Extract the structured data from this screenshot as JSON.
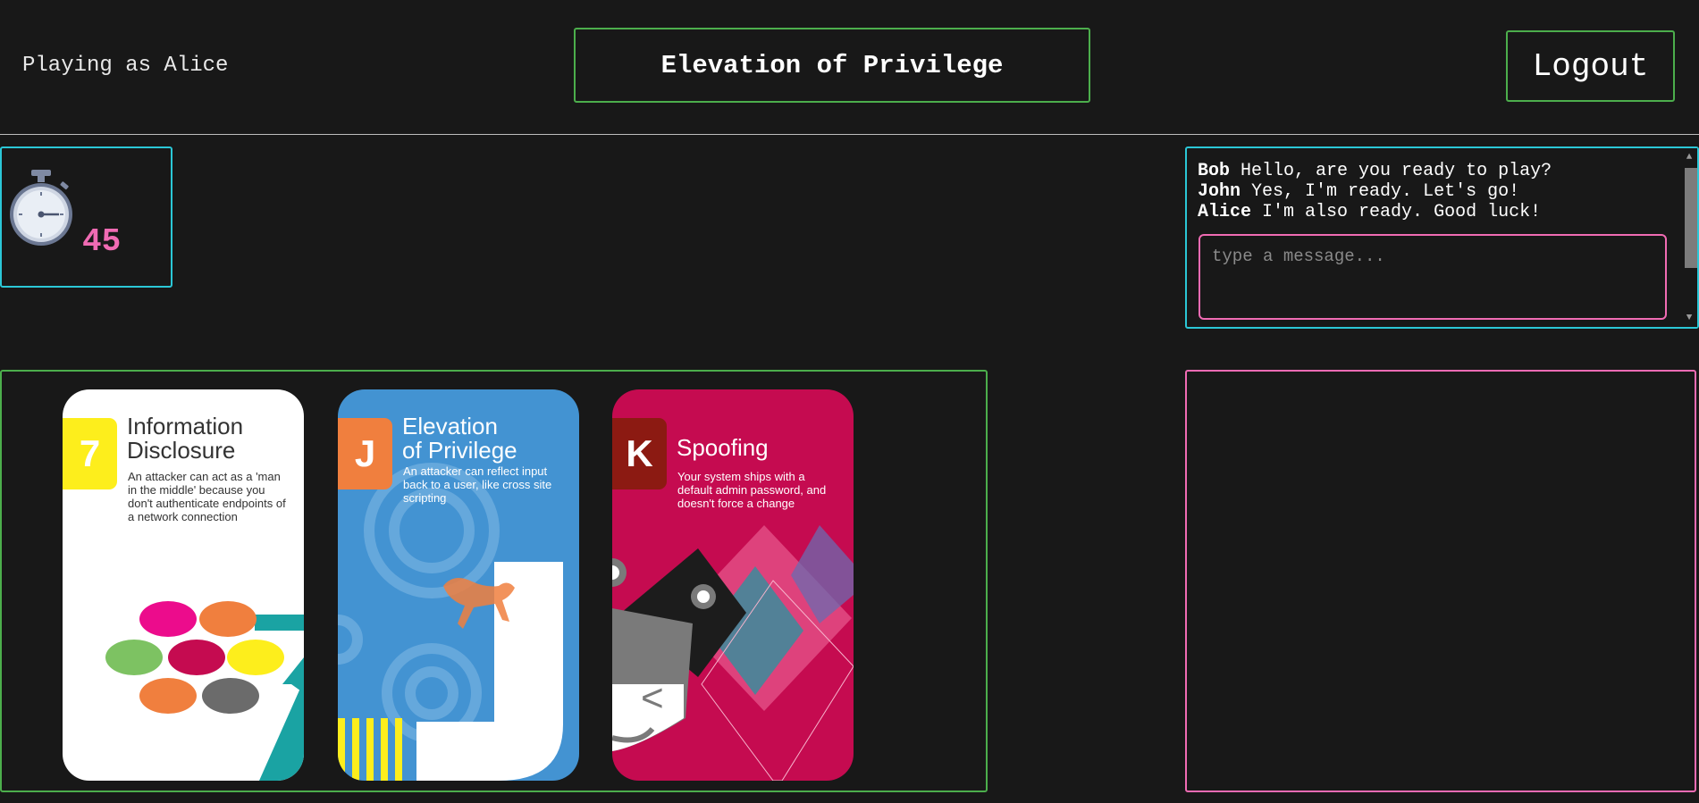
{
  "header": {
    "player_label": "Playing as Alice",
    "title": "Elevation of Privilege",
    "logout_label": "Logout"
  },
  "timer": {
    "value": "45",
    "icon": "stopwatch-icon"
  },
  "chat": {
    "messages": [
      {
        "author": "Bob",
        "text": "Hello, are you ready to play?"
      },
      {
        "author": "John",
        "text": "Yes, I'm ready. Let's go!"
      },
      {
        "author": "Alice",
        "text": "I'm also ready. Good luck!"
      }
    ],
    "input_placeholder": "type a message..."
  },
  "hand": {
    "cards": [
      {
        "rank": "7",
        "suit": "Information\nDisclosure",
        "description": "An attacker can act as a 'man in the middle' because you don't authenticate endpoints of a network connection",
        "background": "#ffffff",
        "badge_color": "#fdee1c",
        "text_color": "#333333"
      },
      {
        "rank": "J",
        "suit": "Elevation\nof Privilege",
        "description": "An attacker can reflect input back to a user, like cross site scripting",
        "background": "#4393d2",
        "badge_color": "#f07f3e",
        "text_color": "#ffffff"
      },
      {
        "rank": "K",
        "suit": "Spoofing",
        "description": "Your system ships with a default admin password, and doesn't force a change",
        "background": "#c50b50",
        "badge_color": "#8c1a12",
        "text_color": "#ffffff"
      }
    ]
  },
  "colors": {
    "green_border": "#4cae4c",
    "cyan_border": "#2bc7d6",
    "pink_accent": "#f06bb3",
    "background": "#181818"
  }
}
